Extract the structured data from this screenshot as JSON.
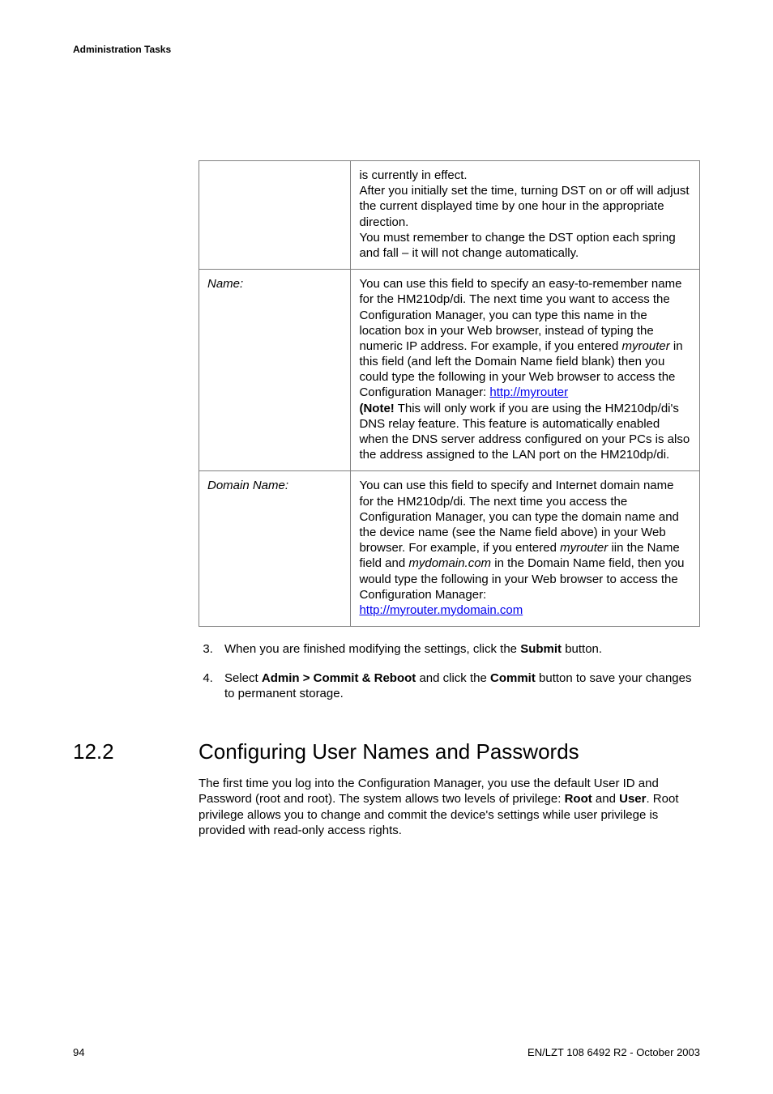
{
  "header": {
    "title": "Administration Tasks"
  },
  "table": {
    "rows": [
      {
        "label": "",
        "desc_parts": [
          {
            "t": "is currently in effect."
          },
          {
            "br": true
          },
          {
            "t": "After you initially set the time, turning DST on or off will adjust the current displayed time by one hour in the appropriate direction."
          },
          {
            "br": true
          },
          {
            "t": "You must remember to change the DST option each spring and fall – it will not change automatically."
          }
        ]
      },
      {
        "label": "Name:",
        "desc_parts": [
          {
            "t": "You can use this field to specify an easy-to-remember name for the HM210dp/di. The next time you want to access the Configuration Manager, you can type this name in the location box in your Web browser, instead of typing the numeric IP address. For example, if you entered "
          },
          {
            "t": "myrouter",
            "italic": true
          },
          {
            "t": " in this field (and left the Domain Name field blank) then you could type the following in your Web browser to access the Configuration Manager: "
          },
          {
            "t": "http://myrouter",
            "link": true
          },
          {
            "br": true
          },
          {
            "t": "(Note!",
            "bold": true
          },
          {
            "t": " This will only work if you are using the HM210dp/di's DNS relay feature. This feature is automatically enabled when the DNS server address configured on your PCs is also the address assigned to the LAN port on the HM210dp/di."
          }
        ]
      },
      {
        "label": "Domain Name:",
        "desc_parts": [
          {
            "t": "You can use this field to specify and Internet domain name for the HM210dp/di. The next time you access the Configuration Manager, you can type the domain name and the device name (see the Name field above) in your Web browser. For example, if you entered "
          },
          {
            "t": "myrouter",
            "italic": true
          },
          {
            "t": " iin the Name field and "
          },
          {
            "t": "mydomain.com",
            "italic": true
          },
          {
            "t": " in the Domain Name field, then you would type the following in your Web browser to access the Configuration Manager:"
          },
          {
            "br": true
          },
          {
            "t": "http://myrouter.mydomain.com",
            "link": true
          }
        ]
      }
    ]
  },
  "steps": [
    {
      "n": "3",
      "parts": [
        {
          "t": "When you are finished modifying the settings, click the "
        },
        {
          "t": "Submit",
          "bold": true
        },
        {
          "t": " button."
        }
      ]
    },
    {
      "n": "4",
      "parts": [
        {
          "t": "Select "
        },
        {
          "t": "Admin > Commit & Reboot",
          "bold": true
        },
        {
          "t": " and click the "
        },
        {
          "t": "Commit",
          "bold": true
        },
        {
          "t": " button to save your changes to permanent storage."
        }
      ]
    }
  ],
  "section": {
    "number": "12.2",
    "title": "Configuring User Names and Passwords",
    "body_parts": [
      {
        "t": "The first time you log into the Configuration Manager, you use the default User ID and Password (root and root). The system allows two levels of privilege: "
      },
      {
        "t": "Root",
        "bold": true
      },
      {
        "t": " and "
      },
      {
        "t": "User",
        "bold": true
      },
      {
        "t": ". Root privilege allows you to change and commit the device's settings while user privilege is provided with read-only access rights."
      }
    ]
  },
  "footer": {
    "left": "94",
    "right": "EN/LZT 108 6492 R2  - October 2003"
  }
}
